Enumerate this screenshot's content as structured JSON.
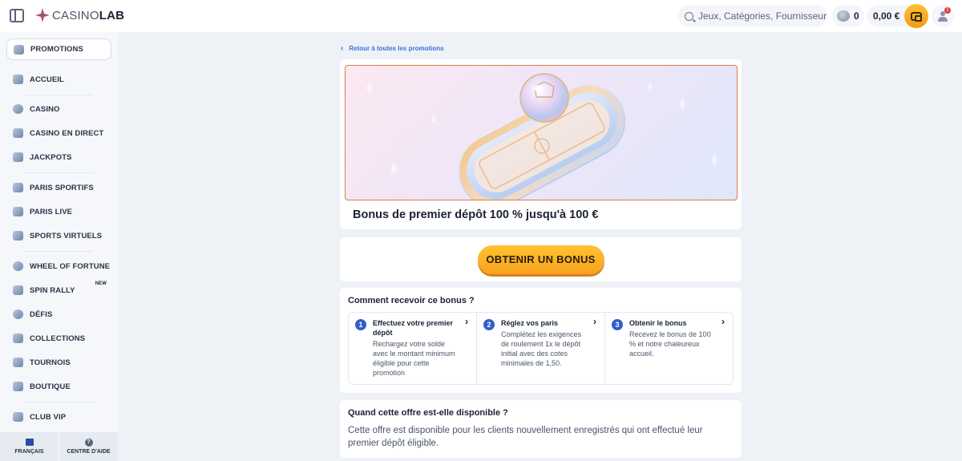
{
  "header": {
    "logo_text_light": "CASINO",
    "logo_text_bold": "LAB",
    "search_placeholder": "Jeux, Catégories, Fournisseurs",
    "coins": "0",
    "balance": "0,00 €",
    "notification_count": "1"
  },
  "sidebar": {
    "items": [
      {
        "label": "PROMOTIONS",
        "icon": "promotions-icon",
        "active": true
      },
      {
        "label": "ACCUEIL",
        "icon": "home-icon"
      },
      {
        "label": "CASINO",
        "icon": "casino-icon"
      },
      {
        "label": "CASINO EN DIRECT",
        "icon": "live-casino-icon"
      },
      {
        "label": "JACKPOTS",
        "icon": "jackpots-icon"
      },
      {
        "label": "PARIS SPORTIFS",
        "icon": "sports-betting-icon"
      },
      {
        "label": "PARIS LIVE",
        "icon": "live-betting-icon"
      },
      {
        "label": "SPORTS VIRTUELS",
        "icon": "virtual-sports-icon"
      },
      {
        "label": "WHEEL OF FORTUNE",
        "icon": "wheel-icon"
      },
      {
        "label": "SPIN RALLY",
        "icon": "spin-rally-icon",
        "badge": "NEW"
      },
      {
        "label": "DÉFIS",
        "icon": "challenges-icon"
      },
      {
        "label": "COLLECTIONS",
        "icon": "collections-icon"
      },
      {
        "label": "TOURNOIS",
        "icon": "trophy-icon"
      },
      {
        "label": "BOUTIQUE",
        "icon": "shop-icon"
      },
      {
        "label": "CLUB VIP",
        "icon": "vip-icon"
      }
    ],
    "footer": {
      "language": "FRANÇAIS",
      "help": "CENTRE D'AIDE",
      "help_glyph": "?"
    }
  },
  "main": {
    "back_link": "Retour à toutes les promotions",
    "promo_title": "Bonus de premier dépôt 100 % jusqu'à 100 €",
    "cta_label": "OBTENIR UN BONUS",
    "how_title": "Comment recevoir ce bonus ?",
    "steps": [
      {
        "num": "1",
        "title": "Effectuez votre premier dépôt",
        "body": "Rechargez votre solde avec le montant minimum éligible pour cette promotion"
      },
      {
        "num": "2",
        "title": "Réglez vos paris",
        "body": "Complétez les exigences de roulement 1x le dépôt initial avec des cotes minimales de 1,50."
      },
      {
        "num": "3",
        "title": "Obtenir le bonus",
        "body": "Recevez le bonus de 100 % et notre chaleureux accueil."
      }
    ],
    "availability_title": "Quand cette offre est-elle disponible ?",
    "availability_body": "Cette offre est disponible pour les clients nouvellement enregistrés qui ont effectué leur premier dépôt éligible."
  },
  "colors": {
    "accent": "#3e6fd8",
    "cta": "#f7a21d",
    "step_badge": "#2f5fc9",
    "hero_border": "#e07848"
  }
}
